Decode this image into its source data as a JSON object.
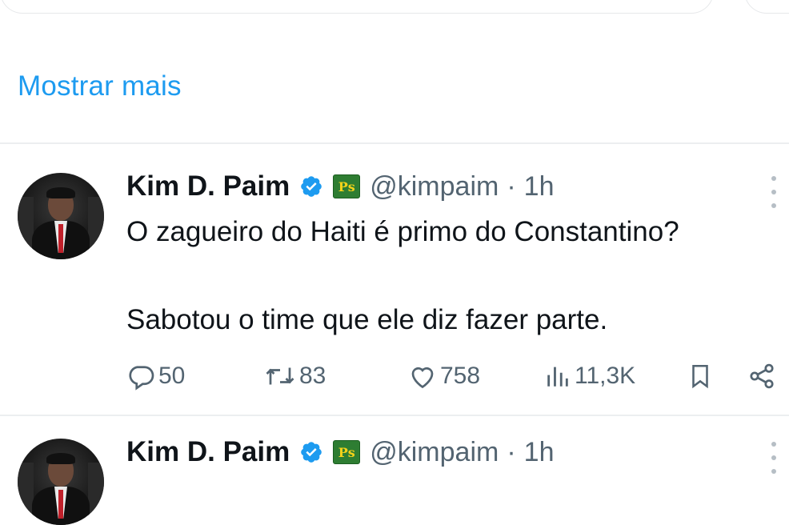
{
  "show_more_label": "Mostrar mais",
  "tweets": [
    {
      "name": "Kim D. Paim",
      "badge_text": "Ps",
      "handle": "@kimpaim",
      "separator": "·",
      "time": "1h",
      "text_line1": "O zagueiro do Haiti é primo do Constantino?",
      "text_line2": "Sabotou o time que ele diz fazer parte.",
      "replies": "50",
      "retweets": "83",
      "likes": "758",
      "views": "11,3K"
    },
    {
      "name": "Kim D. Paim",
      "badge_text": "Ps",
      "handle": "@kimpaim",
      "separator": "·",
      "time": "1h"
    }
  ],
  "colors": {
    "link": "#1d9bf0",
    "muted": "#536471",
    "verified": "#1d9bf0",
    "divider": "#eceef0"
  }
}
